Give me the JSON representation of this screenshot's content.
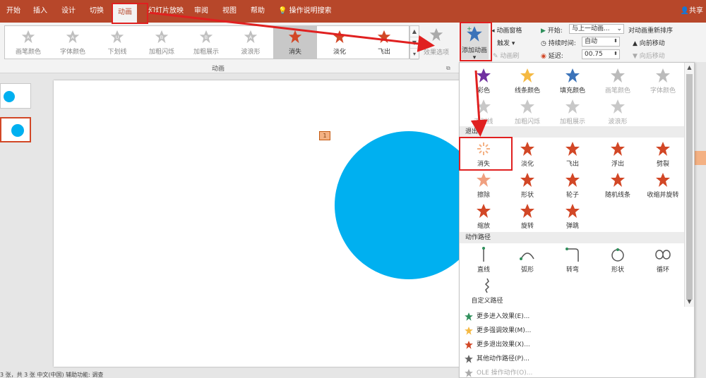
{
  "menu": {
    "tabs": [
      "开始",
      "插入",
      "设计",
      "切换",
      "动画",
      "幻灯片放映",
      "审阅",
      "视图",
      "帮助"
    ],
    "active": "动画",
    "search": "操作说明搜索",
    "share": "共享"
  },
  "ribbon": {
    "gallery": [
      {
        "label": "画笔颜色",
        "icon": "A",
        "state": "dim"
      },
      {
        "label": "字体颜色",
        "icon": "A",
        "state": "dim"
      },
      {
        "label": "下划线",
        "icon": "U",
        "state": "dim"
      },
      {
        "label": "加粗闪烁",
        "icon": "B",
        "state": "dim"
      },
      {
        "label": "加粗展示",
        "icon": "B",
        "state": "dim"
      },
      {
        "label": "波浪形",
        "icon": "A",
        "state": "dim"
      },
      {
        "label": "消失",
        "icon": "",
        "state": "selected"
      },
      {
        "label": "淡化",
        "icon": "",
        "state": "red"
      },
      {
        "label": "飞出",
        "icon": "",
        "state": "red"
      }
    ],
    "effect_options": "效果选项",
    "group_label": "动画",
    "add_animation": "添加动画",
    "animation_pane": "动画窗格",
    "trigger": "触发",
    "animation_painter": "动画刷",
    "start_label": "开始:",
    "start_value": "与上一动画...",
    "duration_label": "持续时间:",
    "duration_value": "自动",
    "delay_label": "延迟:",
    "delay_value": "00.75",
    "reorder": "对动画重新排序",
    "move_earlier": "向前移动",
    "move_later": "向后移动"
  },
  "slide": {
    "badge": "1"
  },
  "statusbar": "3 张，共 3 张    中文(中国)    辅助功能: 调查",
  "dropdown": {
    "emphasis_row1": [
      {
        "label": "彩色",
        "color": "#7030a0",
        "dim": false
      },
      {
        "label": "线条颜色",
        "color": "#f5b942",
        "dim": false
      },
      {
        "label": "填充颜色",
        "color": "#3b73b9",
        "dim": false
      },
      {
        "label": "画笔颜色",
        "color": "#bbbbbb",
        "dim": true
      },
      {
        "label": "字体颜色",
        "color": "#bbbbbb",
        "dim": true
      }
    ],
    "emphasis_row2": [
      {
        "label": "下划线",
        "dim": true
      },
      {
        "label": "加粗闪烁",
        "dim": true
      },
      {
        "label": "加粗展示",
        "dim": true
      },
      {
        "label": "波浪形",
        "dim": true
      }
    ],
    "exit_section": "退出",
    "exit_row1": [
      "消失",
      "淡化",
      "飞出",
      "浮出",
      "劈裂"
    ],
    "exit_row2": [
      "擦除",
      "形状",
      "轮子",
      "随机线条",
      "收缩并旋转"
    ],
    "exit_row3": [
      "缩放",
      "旋转",
      "弹跳"
    ],
    "path_section": "动作路径",
    "path_row": [
      "直线",
      "弧形",
      "转弯",
      "形状",
      "循环"
    ],
    "custom_path": "自定义路径",
    "more": [
      {
        "label": "更多进入效果(E)...",
        "color": "#2f8f5b",
        "dim": false
      },
      {
        "label": "更多强调效果(M)...",
        "color": "#f5b942",
        "dim": false
      },
      {
        "label": "更多退出效果(X)...",
        "color": "#d24726",
        "dim": false
      },
      {
        "label": "其他动作路径(P)...",
        "color": "#666666",
        "dim": false
      },
      {
        "label": "OLE 操作动作(O)...",
        "color": "#aaaaaa",
        "dim": true
      }
    ]
  },
  "colors": {
    "accent": "#b7472a",
    "exit": "#d24726",
    "circle": "#00b0f0",
    "highlight": "#e02020"
  }
}
